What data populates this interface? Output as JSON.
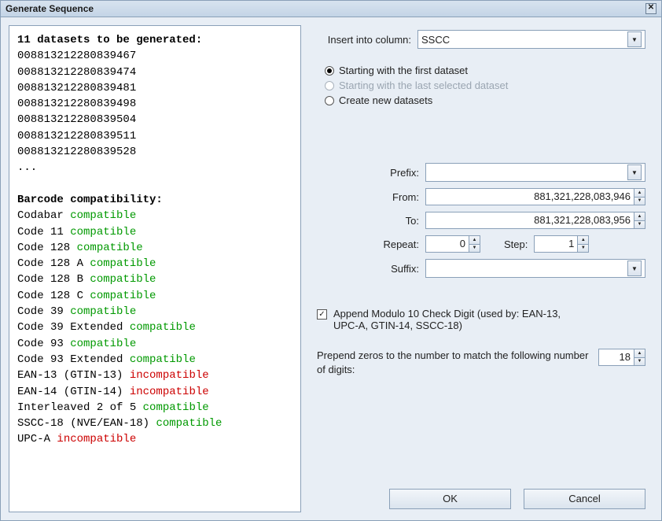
{
  "window": {
    "title": "Generate Sequence"
  },
  "preview": {
    "heading": "11 datasets to be generated:",
    "datasets": [
      "00881321228083946 7",
      "00881321228083947 4",
      "00881321228083948 1",
      "00881321228083949 8",
      "00881321228083950 4",
      "00881321228083951 1",
      "00881321228083952 8",
      "..."
    ],
    "compat_heading": "Barcode compatibility:",
    "compat": [
      {
        "name": "Codabar",
        "status": "compatible"
      },
      {
        "name": "Code 11",
        "status": "compatible"
      },
      {
        "name": "Code 128",
        "status": "compatible"
      },
      {
        "name": "Code 128 A",
        "status": "compatible"
      },
      {
        "name": "Code 128 B",
        "status": "compatible"
      },
      {
        "name": "Code 128 C",
        "status": "compatible"
      },
      {
        "name": "Code 39",
        "status": "compatible"
      },
      {
        "name": "Code 39 Extended",
        "status": "compatible"
      },
      {
        "name": "Code 93",
        "status": "compatible"
      },
      {
        "name": "Code 93 Extended",
        "status": "compatible"
      },
      {
        "name": "EAN-13 (GTIN-13)",
        "status": "incompatible"
      },
      {
        "name": "EAN-14 (GTIN-14)",
        "status": "incompatible"
      },
      {
        "name": "Interleaved 2 of 5",
        "status": "compatible"
      },
      {
        "name": "SSCC-18 (NVE/EAN-18)",
        "status": "compatible"
      },
      {
        "name": "UPC-A",
        "status": "incompatible"
      }
    ]
  },
  "form": {
    "insert_label": "Insert into column:",
    "insert_value": "SSCC",
    "radio": {
      "first": "Starting with the first dataset",
      "last": "Starting with the last selected dataset",
      "create": "Create new datasets",
      "selected": "first",
      "disabled": "last"
    },
    "prefix_label": "Prefix:",
    "prefix_value": "",
    "from_label": "From:",
    "from_value": "881,321,228,083,946",
    "to_label": "To:",
    "to_value": "881,321,228,083,956",
    "repeat_label": "Repeat:",
    "repeat_value": "0",
    "step_label": "Step:",
    "step_value": "1",
    "suffix_label": "Suffix:",
    "suffix_value": "",
    "append_checked": true,
    "append_label": "Append Modulo 10 Check Digit (used by: EAN-13, UPC-A, GTIN-14, SSCC-18)",
    "prepend_label": "Prepend zeros to the number to match the following number of digits:",
    "prepend_value": "18"
  },
  "buttons": {
    "ok": "OK",
    "cancel": "Cancel"
  }
}
